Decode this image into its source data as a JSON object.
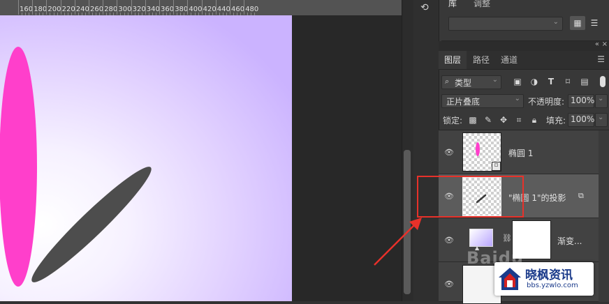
{
  "ruler": {
    "labels": [
      "160",
      "180",
      "200",
      "220",
      "240",
      "260",
      "280",
      "300",
      "320",
      "340",
      "360",
      "380",
      "400",
      "420",
      "440",
      "460",
      "480"
    ]
  },
  "panel_top": {
    "tab_library": "库",
    "tab_adjust": "调整"
  },
  "layers_panel": {
    "tabs": [
      "图层",
      "路径",
      "通道"
    ],
    "filter_kind": "类型",
    "blend_mode": "正片叠底",
    "opacity_label": "不透明度:",
    "opacity_value": "100%",
    "lock_label": "锁定:",
    "fill_label": "填充:",
    "fill_value": "100%",
    "layers": [
      {
        "name": "椭圆 1"
      },
      {
        "name": "\"椭圆 1\"的投影"
      },
      {
        "name": "渐变..."
      }
    ]
  },
  "watermark": {
    "title": "晓枫资讯",
    "url": "bbs.yzwlo.com",
    "baidu": "Baidu"
  },
  "colors": {
    "ellipse": "#ff3fcb",
    "shadow": "#4d4d4d",
    "annotation": "#e8312a",
    "selected_layer": "#5c5c5c"
  }
}
